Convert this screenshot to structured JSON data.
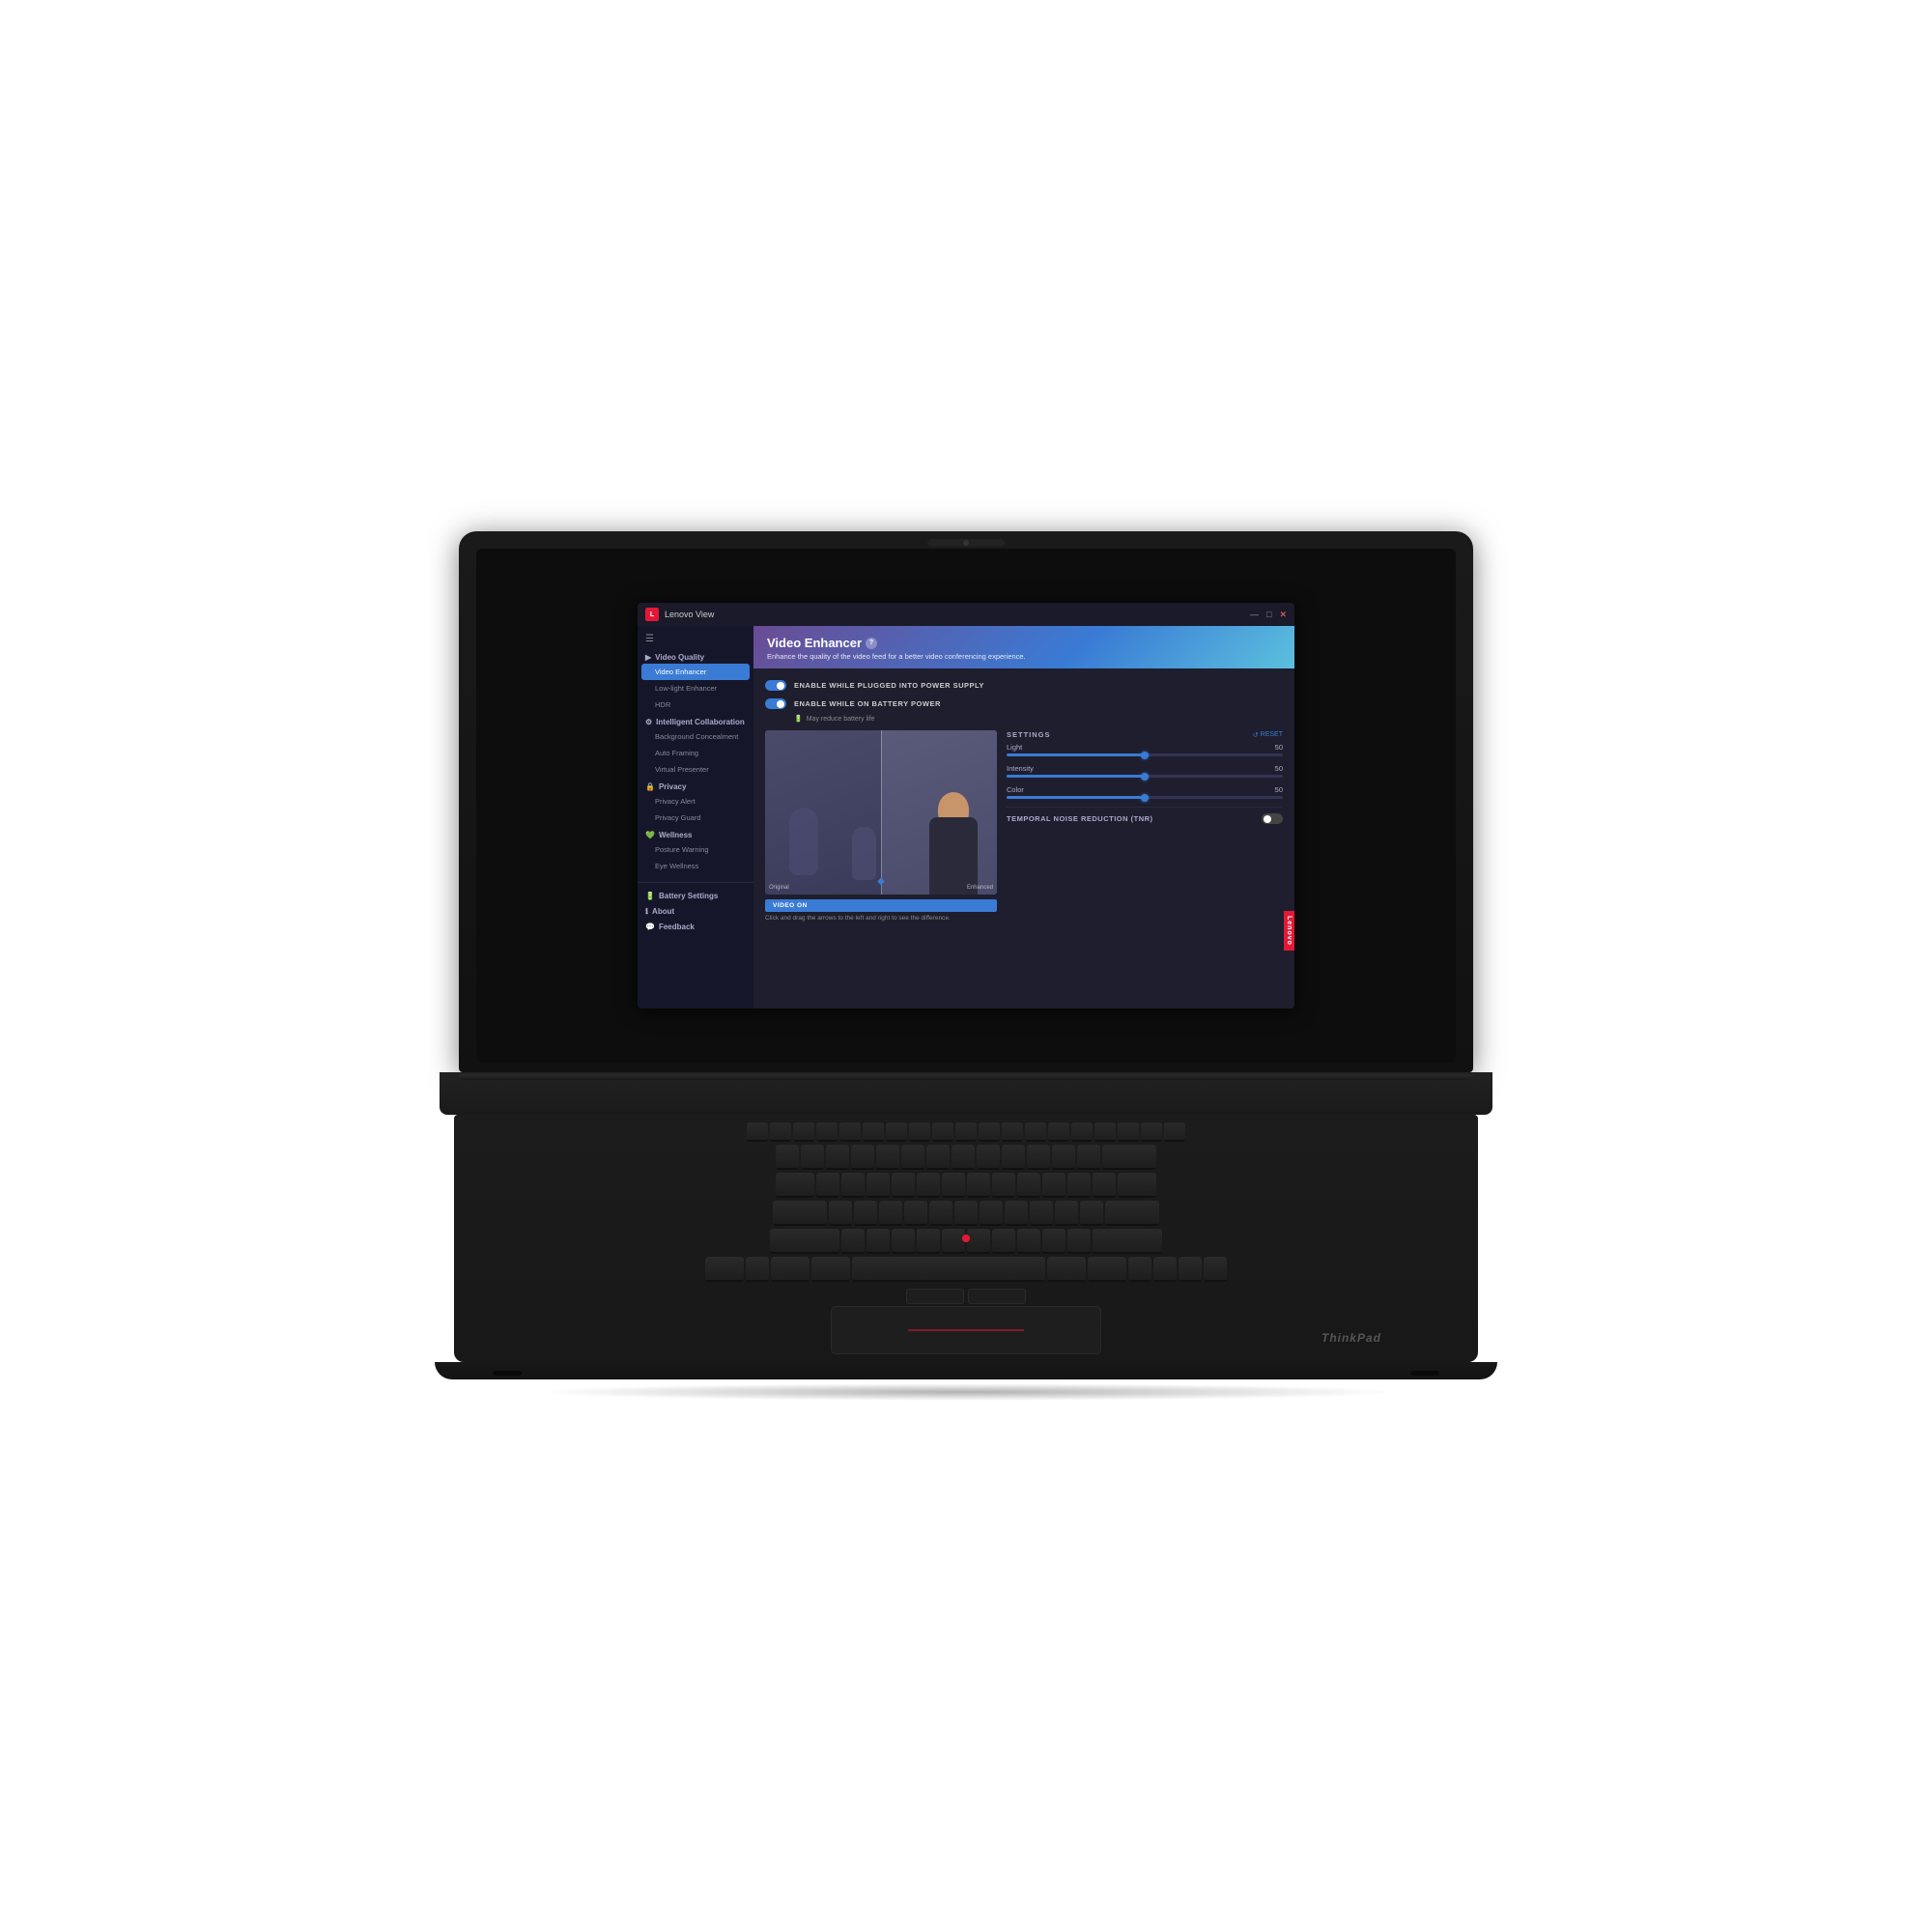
{
  "app": {
    "title": "Lenovo View",
    "window_controls": {
      "minimize": "—",
      "maximize": "□",
      "close": "✕"
    }
  },
  "sidebar": {
    "menu_icon": "☰",
    "sections": [
      {
        "name": "Video Quality",
        "icon": "🎬",
        "items": [
          {
            "label": "Video Enhancer",
            "active": true
          },
          {
            "label": "Low-light Enhancer",
            "active": false
          },
          {
            "label": "HDR",
            "active": false
          }
        ]
      },
      {
        "name": "Intelligent Collaboration",
        "icon": "👥",
        "items": [
          {
            "label": "Background Concealment",
            "active": false
          },
          {
            "label": "Auto Framing",
            "active": false
          },
          {
            "label": "Virtual Presenter",
            "active": false
          }
        ]
      },
      {
        "name": "Privacy",
        "icon": "🔒",
        "items": [
          {
            "label": "Privacy Alert",
            "active": false
          },
          {
            "label": "Privacy Guard",
            "active": false
          }
        ]
      },
      {
        "name": "Wellness",
        "icon": "💚",
        "items": [
          {
            "label": "Posture Warning",
            "active": false
          },
          {
            "label": "Eye Wellness",
            "active": false
          }
        ]
      }
    ],
    "bottom_items": [
      {
        "label": "Battery Settings",
        "icon": "🔋"
      },
      {
        "label": "About",
        "icon": "ℹ"
      },
      {
        "label": "Feedback",
        "icon": "💬"
      }
    ]
  },
  "main": {
    "header": {
      "title": "Video Enhancer",
      "help_icon": "?",
      "subtitle": "Enhance the quality of the video feed for a better video conferencing experience."
    },
    "toggles": [
      {
        "label": "ENABLE WHILE PLUGGED INTO POWER SUPPLY",
        "enabled": true
      },
      {
        "label": "ENABLE WHILE ON BATTERY POWER",
        "enabled": true,
        "note": "May reduce battery life",
        "note_icon": "🔋"
      }
    ],
    "settings": {
      "title": "SETTINGS",
      "reset_label": "RESET",
      "sliders": [
        {
          "label": "Light",
          "value": 50,
          "percent": 50
        },
        {
          "label": "Intensity",
          "value": 50,
          "percent": 50
        },
        {
          "label": "Color",
          "value": 50,
          "percent": 50
        }
      ],
      "tnr": {
        "label": "TEMPORAL NOISE REDUCTION (TNR)",
        "enabled": false
      }
    },
    "video": {
      "label_original": "Original",
      "label_enhanced": "Enhanced",
      "btn_label": "VIDEO ON",
      "drag_hint": "Click and drag the arrows to the left and right to see the difference."
    }
  },
  "branding": {
    "lenovo": "Lenovo",
    "thinkpad": "ThinkPad"
  }
}
